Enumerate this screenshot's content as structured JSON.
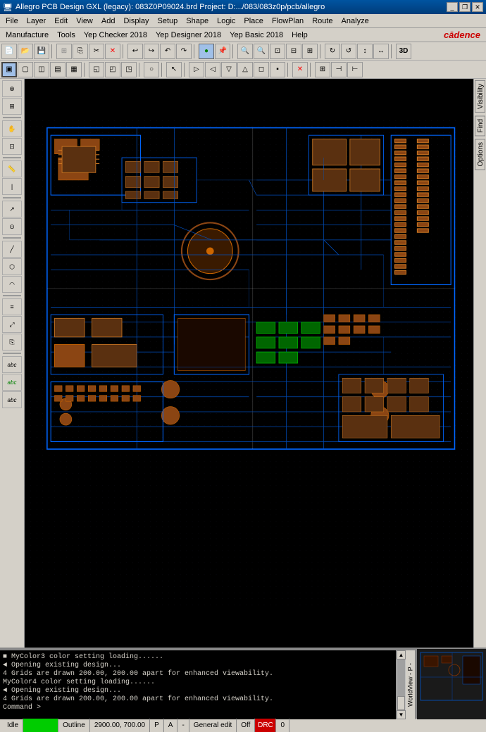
{
  "titlebar": {
    "text": "Allegro PCB Design GXL (legacy): 083Z0P09024.brd  Project: D:.../083/083z0p/pcb/allegro",
    "icon": "🖥"
  },
  "titlebar_controls": {
    "minimize": "_",
    "restore": "❐",
    "close": "✕"
  },
  "menus": {
    "row1": [
      "File",
      "Layer",
      "Edit",
      "View",
      "Add",
      "Display",
      "Setup",
      "Shape",
      "Logic",
      "Place",
      "FlowPlan",
      "Route",
      "Analyze"
    ],
    "row2": [
      "Manufacture",
      "Tools",
      "Yep Checker 2018",
      "Yep Designer 2018",
      "Yep Basic 2018",
      "Help"
    ]
  },
  "cadence_logo": "cādence",
  "console": {
    "lines": [
      {
        "bullet": "■",
        "text": "MyColor3 color setting loading......",
        "color": "#d4d0c8"
      },
      {
        "bullet": "◄",
        "text": "Opening existing design...",
        "color": "#d4d0c8"
      },
      {
        "bullet": "4",
        "text": "Grids are drawn 200.00, 200.00 apart for enhanced viewability.",
        "color": "#d4d0c8"
      },
      {
        "bullet": "",
        "text": "MyColor4 color setting loading......",
        "color": "#d4d0c8"
      },
      {
        "bullet": "◄",
        "text": "Opening existing design...",
        "color": "#d4d0c8"
      },
      {
        "bullet": "4",
        "text": "Grids are drawn 200.00, 200.00 apart for enhanced viewability.",
        "color": "#d4d0c8"
      },
      {
        "bullet": "",
        "text": "Command >",
        "color": "#d4d0c8"
      }
    ]
  },
  "right_tabs": [
    "Visibility",
    "Find",
    "Options"
  ],
  "worldview_label": "WorldView - P -",
  "status": {
    "mode": "Idle",
    "green_indicator": "",
    "outline": "Outline",
    "coords": "2900.00, 700.00",
    "p_indicator": "P",
    "angle_indicator": "A",
    "separator1": "-",
    "edit_mode": "General edit",
    "off_label": "Off",
    "red_indicator": "DRC",
    "number": "0"
  }
}
